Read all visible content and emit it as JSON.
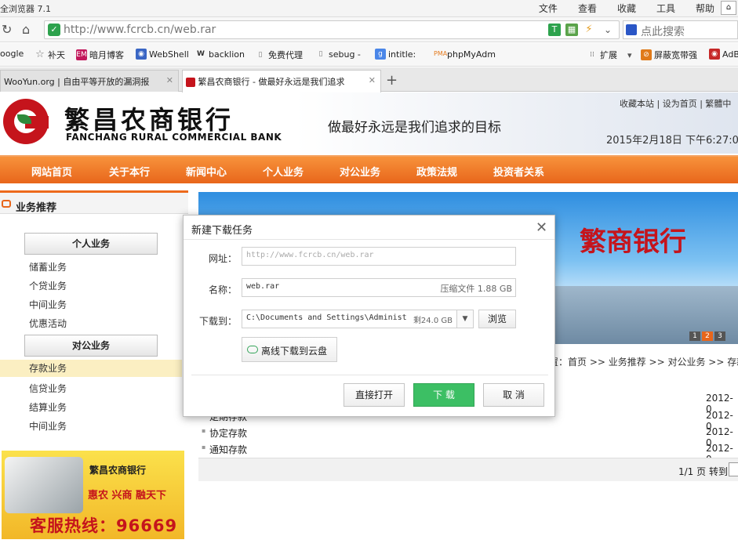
{
  "browser": {
    "title_fragment": "全浏览器 7.1",
    "menus": [
      "文件",
      "查看",
      "收藏",
      "工具",
      "帮助"
    ],
    "url": "http://www.fcrcb.cn/web.rar",
    "search_placeholder": "点此搜索"
  },
  "bookmarks": [
    "oogle",
    "补天",
    "暗月博客",
    "WebShell",
    "backlion",
    "免费代理",
    "sebug -",
    "intitle:",
    "phpMyAdm",
    "扩展",
    "屏蔽宽带强",
    "AdB"
  ],
  "tabs": [
    {
      "label": "WooYun.org | 自由平等开放的漏洞报"
    },
    {
      "label": "繁昌农商银行 - 做最好永远是我们追求"
    }
  ],
  "site": {
    "bank_cn": "繁昌农商银行",
    "bank_en": "FANCHANG RURAL COMMERCIAL BANK",
    "slogan": "做最好永远是我们追求的目标",
    "top_links": "收藏本站 | 设为首页 | 繁體中",
    "datetime": "2015年2月18日 下午6:27:0",
    "nav": [
      "网站首页",
      "关于本行",
      "新闻中心",
      "个人业务",
      "对公业务",
      "政策法规",
      "投资者关系"
    ],
    "sidebar": {
      "title": "业务推荐",
      "personal": "个人业务",
      "personal_items": [
        "储蓄业务",
        "个贷业务",
        "中间业务",
        "优惠活动"
      ],
      "corporate": "对公业务",
      "corporate_items": [
        "存款业务",
        "信贷业务",
        "结算业务",
        "中间业务"
      ]
    },
    "hero_text": "繁商银行",
    "hero_pager": [
      "1",
      "2",
      "3"
    ],
    "breadcrumb": "置：首页 >> 业务推荐 >> 对公业务 >> 存款",
    "rows": [
      {
        "title": "",
        "date": "2012-0"
      },
      {
        "title": "定期存款",
        "date": "2012-0"
      },
      {
        "title": "协定存款",
        "date": "2012-0"
      },
      {
        "title": "通知存款",
        "date": "2012-0"
      }
    ],
    "pager": "1/1 页 转到",
    "ad": {
      "name": "繁昌农商银行",
      "slogan": "惠农 兴商 融天下",
      "hotline": "客服热线：96669"
    }
  },
  "dialog": {
    "title": "新建下载任务",
    "url_label": "网址：",
    "url_value": "http://www.fcrcb.cn/web.rar",
    "name_label": "名称：",
    "name_value": "web.rar",
    "name_info": "压缩文件 1.88 GB",
    "path_label": "下载到：",
    "path_value": "C:\\Documents and Settings\\Administ",
    "free_space": "剩24.0 GB",
    "browse": "浏览",
    "cloud": "离线下载到云盘",
    "open": "直接打开",
    "download": "下 载",
    "cancel": "取 消"
  }
}
